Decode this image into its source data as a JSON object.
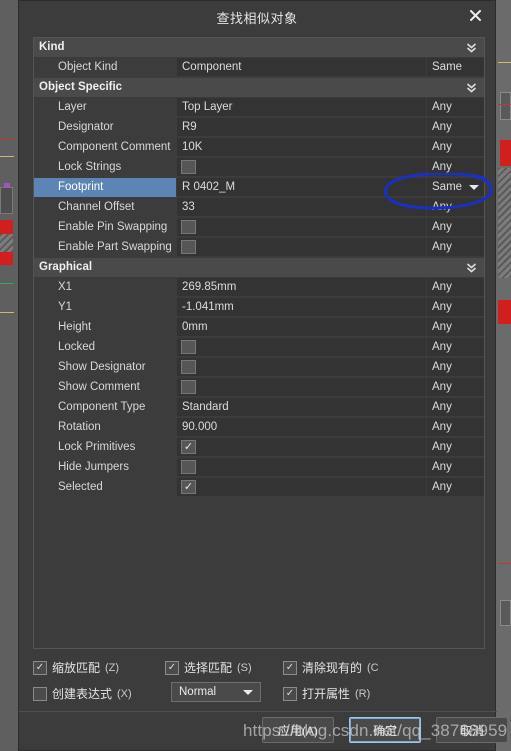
{
  "window": {
    "title": "查找相似对象",
    "close_icon": "close-icon"
  },
  "grid": {
    "rows": [
      {
        "type": "group",
        "label": "Kind",
        "icon": "chevron-double-down-icon"
      },
      {
        "type": "item",
        "name": "Object Kind",
        "value": "Component",
        "value_type": "text",
        "mode": "Same",
        "selected": false,
        "mode_caret": false
      },
      {
        "type": "group",
        "label": "Object Specific",
        "icon": "chevron-double-down-icon"
      },
      {
        "type": "item",
        "name": "Layer",
        "value": "Top Layer",
        "value_type": "text",
        "mode": "Any",
        "selected": false,
        "mode_caret": false
      },
      {
        "type": "item",
        "name": "Designator",
        "value": "R9",
        "value_type": "text",
        "mode": "Any",
        "selected": false,
        "mode_caret": false
      },
      {
        "type": "item",
        "name": "Component Comment",
        "value": "10K",
        "value_type": "text",
        "mode": "Any",
        "selected": false,
        "mode_caret": false
      },
      {
        "type": "item",
        "name": "Lock Strings",
        "value": "",
        "value_type": "checkbox",
        "checked": false,
        "mode": "Any",
        "selected": false,
        "mode_caret": false
      },
      {
        "type": "item",
        "name": "Footprint",
        "value": "R 0402_M",
        "value_type": "text",
        "mode": "Same",
        "selected": true,
        "mode_caret": true
      },
      {
        "type": "item",
        "name": "Channel Offset",
        "value": "33",
        "value_type": "text",
        "mode": "Any",
        "selected": false,
        "mode_caret": false
      },
      {
        "type": "item",
        "name": "Enable Pin Swapping",
        "value": "",
        "value_type": "checkbox",
        "checked": false,
        "mode": "Any",
        "selected": false,
        "mode_caret": false
      },
      {
        "type": "item",
        "name": "Enable Part Swapping",
        "value": "",
        "value_type": "checkbox",
        "checked": false,
        "mode": "Any",
        "selected": false,
        "mode_caret": false
      },
      {
        "type": "group",
        "label": "Graphical",
        "icon": "chevron-double-down-icon"
      },
      {
        "type": "item",
        "name": "X1",
        "value": "269.85mm",
        "value_type": "text",
        "mode": "Any",
        "selected": false,
        "mode_caret": false
      },
      {
        "type": "item",
        "name": "Y1",
        "value": "-1.041mm",
        "value_type": "text",
        "mode": "Any",
        "selected": false,
        "mode_caret": false
      },
      {
        "type": "item",
        "name": "Height",
        "value": "0mm",
        "value_type": "text",
        "mode": "Any",
        "selected": false,
        "mode_caret": false
      },
      {
        "type": "item",
        "name": "Locked",
        "value": "",
        "value_type": "checkbox",
        "checked": false,
        "mode": "Any",
        "selected": false,
        "mode_caret": false
      },
      {
        "type": "item",
        "name": "Show Designator",
        "value": "",
        "value_type": "checkbox",
        "checked": false,
        "mode": "Any",
        "selected": false,
        "mode_caret": false
      },
      {
        "type": "item",
        "name": "Show Comment",
        "value": "",
        "value_type": "checkbox",
        "checked": false,
        "mode": "Any",
        "selected": false,
        "mode_caret": false
      },
      {
        "type": "item",
        "name": "Component Type",
        "value": "Standard",
        "value_type": "text",
        "mode": "Any",
        "selected": false,
        "mode_caret": false
      },
      {
        "type": "item",
        "name": "Rotation",
        "value": "90.000",
        "value_type": "text",
        "mode": "Any",
        "selected": false,
        "mode_caret": false
      },
      {
        "type": "item",
        "name": "Lock Primitives",
        "value": "",
        "value_type": "checkbox",
        "checked": true,
        "mode": "Any",
        "selected": false,
        "mode_caret": false
      },
      {
        "type": "item",
        "name": "Hide Jumpers",
        "value": "",
        "value_type": "checkbox",
        "checked": false,
        "mode": "Any",
        "selected": false,
        "mode_caret": false
      },
      {
        "type": "item",
        "name": "Selected",
        "value": "",
        "value_type": "checkbox",
        "checked": true,
        "mode": "Any",
        "selected": false,
        "mode_caret": false
      }
    ]
  },
  "options": {
    "zoom_match": {
      "label": "缩放匹配",
      "accel": "(Z)",
      "checked": true
    },
    "select_match": {
      "label": "选择匹配",
      "accel": "(S)",
      "checked": true
    },
    "clear_existing": {
      "label": "清除现有的",
      "accel": "(C",
      "checked": true
    },
    "create_expression": {
      "label": "创建表达式",
      "accel": "(X)",
      "checked": false
    },
    "open_properties": {
      "label": "打开属性",
      "accel": "(R)",
      "checked": true
    },
    "run_mode": {
      "value": "Normal",
      "caret": "chevron-down-icon"
    }
  },
  "buttons": {
    "apply": "应用(A)",
    "ok": "确定",
    "cancel": "取消"
  },
  "overlay": {
    "watermark": "https://blog.csdn.net/qq_38768959",
    "annotation_color": "#1a2fc4",
    "annotation_name": "hand-drawn-ellipse-annotation"
  },
  "colors": {
    "accent_selection": "#5c85b5",
    "dialog_bg": "#3c3c3c",
    "group_bg": "#4a4a4a",
    "field_bg": "#333333"
  }
}
